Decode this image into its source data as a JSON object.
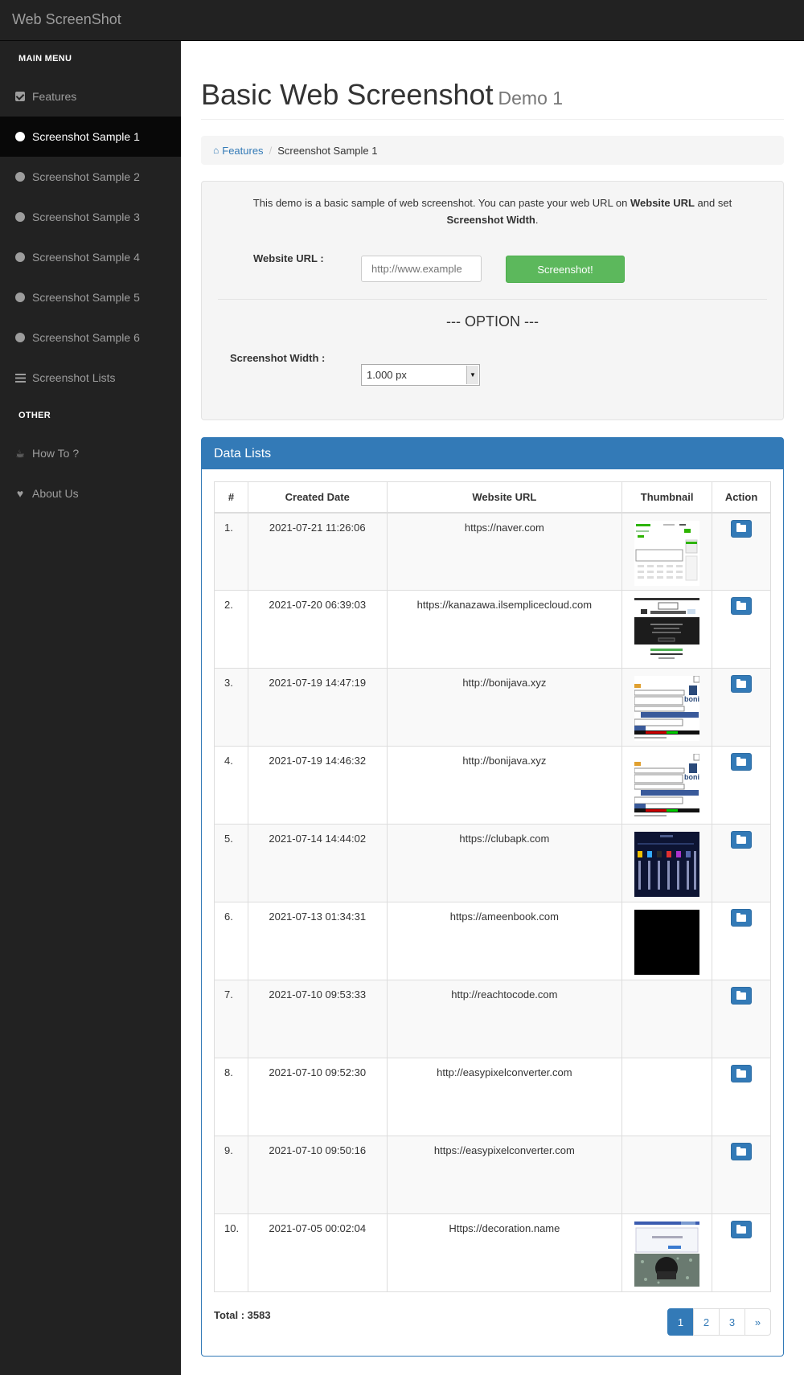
{
  "brand": "Web ScreenShot",
  "sidebar": {
    "main_header": "MAIN MENU",
    "other_header": "OTHER",
    "items": [
      {
        "label": "Features",
        "icon": "check-square-icon"
      },
      {
        "label": "Screenshot Sample 1",
        "icon": "circle-icon",
        "active": true
      },
      {
        "label": "Screenshot Sample 2",
        "icon": "circle-icon"
      },
      {
        "label": "Screenshot Sample 3",
        "icon": "circle-icon"
      },
      {
        "label": "Screenshot Sample 4",
        "icon": "circle-icon"
      },
      {
        "label": "Screenshot Sample 5",
        "icon": "circle-icon"
      },
      {
        "label": "Screenshot Sample 6",
        "icon": "circle-icon"
      },
      {
        "label": "Screenshot Lists",
        "icon": "list-icon"
      }
    ],
    "other_items": [
      {
        "label": "How To ?",
        "icon": "coffee-icon"
      },
      {
        "label": "About Us",
        "icon": "heart-icon"
      }
    ]
  },
  "header": {
    "title": "Basic Web Screenshot",
    "subtitle": "Demo 1"
  },
  "breadcrumb": {
    "home": "Features",
    "current": "Screenshot Sample 1"
  },
  "form": {
    "desc_1": "This demo is a basic sample of web screenshot. You can paste your web URL on ",
    "desc_b1": "Website URL",
    "desc_2": " and set ",
    "desc_b2": "Screenshot Width",
    "desc_3": ".",
    "url_label": "Website URL :",
    "url_placeholder": "http://www.example",
    "submit_label": "Screenshot!",
    "option_title": "--- OPTION ---",
    "width_label": "Screenshot Width :",
    "width_value": "1.000 px"
  },
  "data_panel": {
    "title": "Data Lists",
    "columns": [
      "#",
      "Created Date",
      "Website URL",
      "Thumbnail",
      "Action"
    ],
    "rows": [
      {
        "num": "1.",
        "date": "2021-07-21 11:26:06",
        "url": "https://naver.com",
        "thumb": "light"
      },
      {
        "num": "2.",
        "date": "2021-07-20 06:39:03",
        "url": "https://kanazawa.ilsemplicecloud.com",
        "thumb": "dark-band"
      },
      {
        "num": "3.",
        "date": "2021-07-19 14:47:19",
        "url": "http://bonijava.xyz",
        "thumb": "form"
      },
      {
        "num": "4.",
        "date": "2021-07-19 14:46:32",
        "url": "http://bonijava.xyz",
        "thumb": "form"
      },
      {
        "num": "5.",
        "date": "2021-07-14 14:44:02",
        "url": "https://clubapk.com",
        "thumb": "navy"
      },
      {
        "num": "6.",
        "date": "2021-07-13 01:34:31",
        "url": "https://ameenbook.com",
        "thumb": "black"
      },
      {
        "num": "7.",
        "date": "2021-07-10 09:53:33",
        "url": "http://reachtocode.com",
        "thumb": "none"
      },
      {
        "num": "8.",
        "date": "2021-07-10 09:52:30",
        "url": "http://easypixelconverter.com",
        "thumb": "none"
      },
      {
        "num": "9.",
        "date": "2021-07-10 09:50:16",
        "url": "https://easypixelconverter.com",
        "thumb": "none"
      },
      {
        "num": "10.",
        "date": "2021-07-05 00:02:04",
        "url": "Https://decoration.name",
        "thumb": "photo"
      }
    ],
    "total": "Total : 3583",
    "pages": [
      "1",
      "2",
      "3",
      "»"
    ],
    "active_page": "1"
  },
  "colors": {
    "sidebar_bg": "#222222",
    "primary": "#337ab7",
    "success": "#5cb85c"
  }
}
